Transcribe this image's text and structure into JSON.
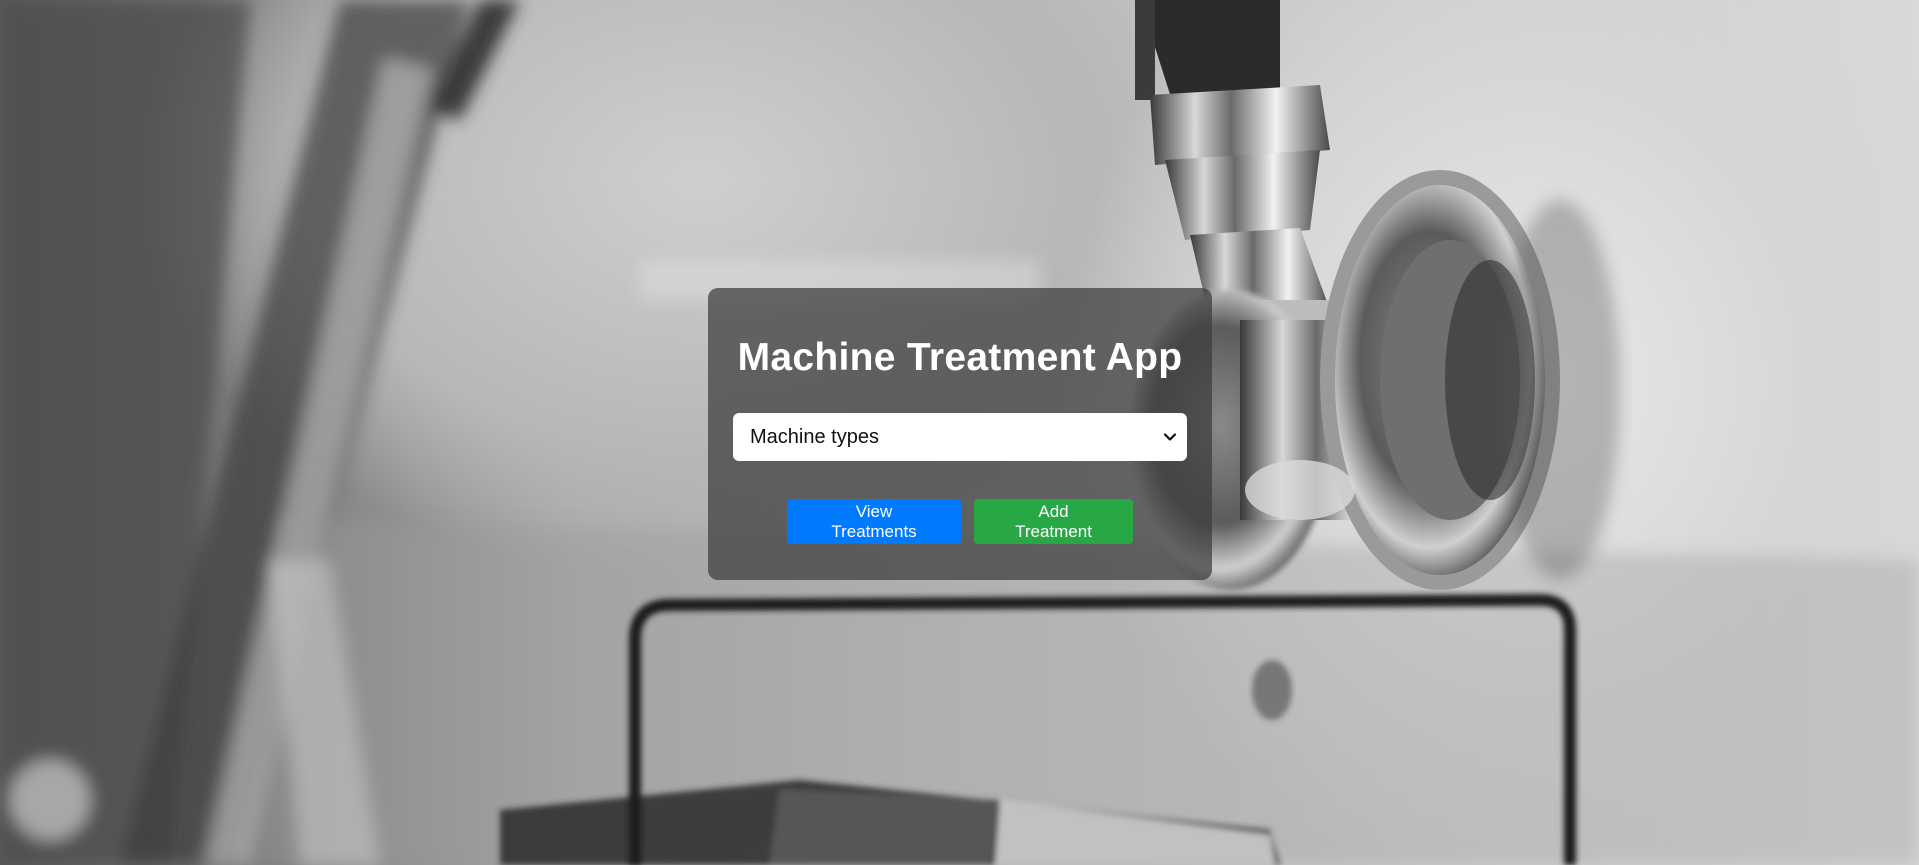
{
  "app": {
    "title": "Machine Treatment App"
  },
  "machine_select": {
    "selected": "Machine types"
  },
  "buttons": {
    "view_label": "View Treatments",
    "add_label": "Add Treatment"
  },
  "colors": {
    "view_button": "#007bff",
    "add_button": "#28a745",
    "card_background": "rgba(60,60,60,0.72)"
  },
  "icons": {
    "select_arrow": "chevron-down-icon"
  }
}
